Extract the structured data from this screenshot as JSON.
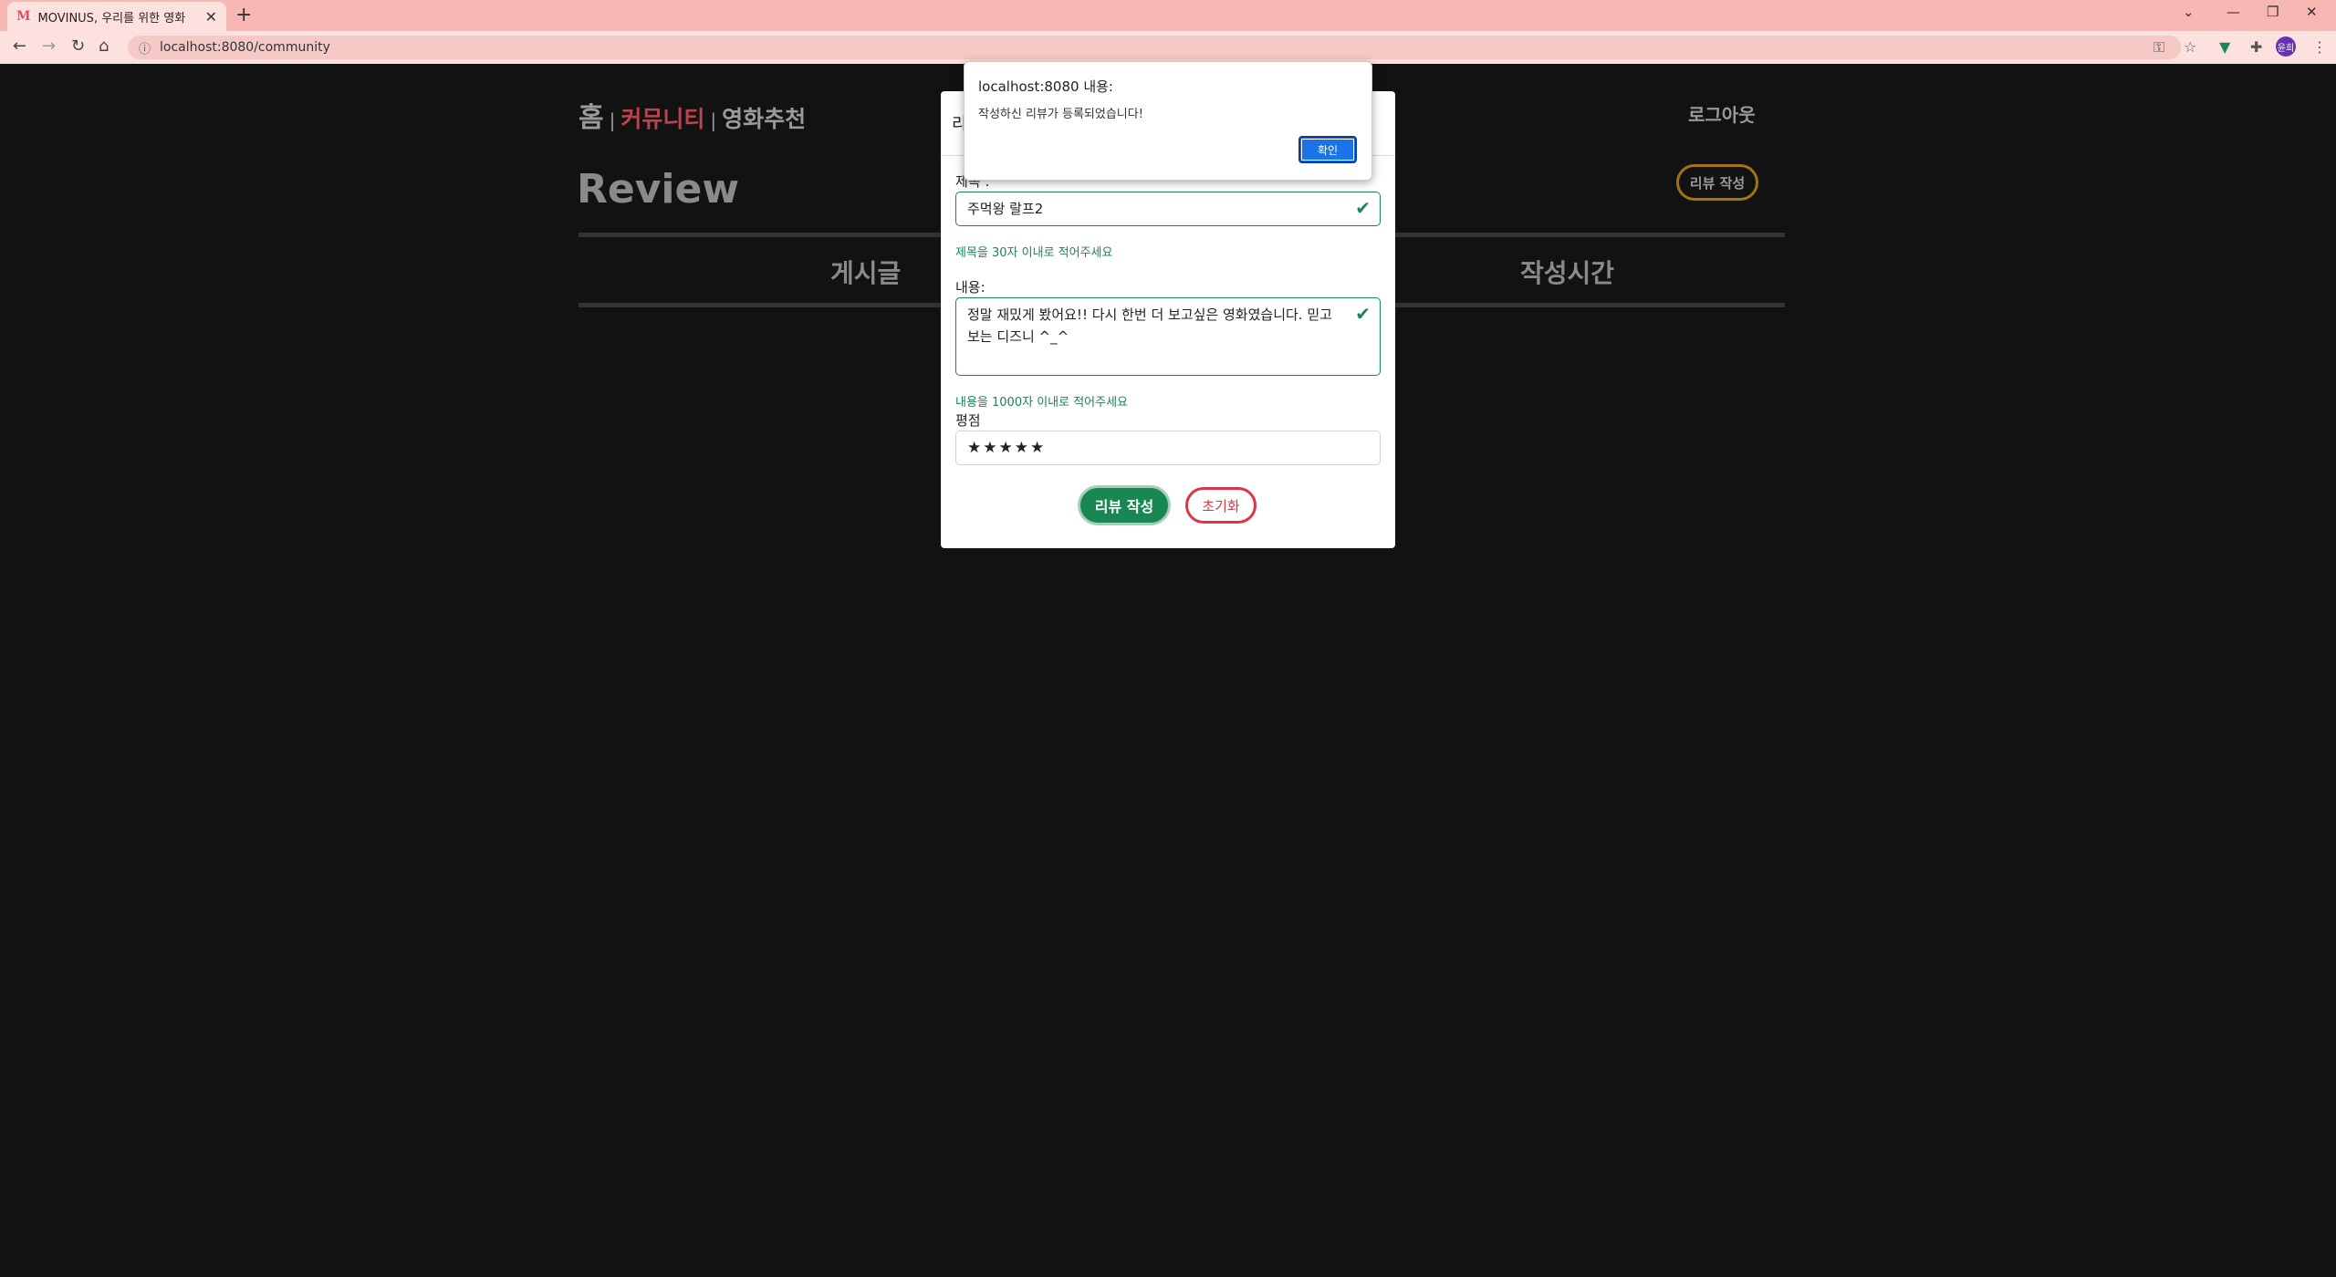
{
  "browser": {
    "tab_title": "MOVINUS, 우리를 위한 영화",
    "favicon": "M",
    "url": "localhost:8080/community",
    "profile_initials": "윤희"
  },
  "nav": {
    "home": "홈",
    "separator": "|",
    "community": "커뮤니티",
    "recommend": "영화추천",
    "logout": "로그아웃"
  },
  "page": {
    "title": "Review",
    "write_button": "리뷰 작성",
    "columns": [
      "게시글",
      "작성시간"
    ]
  },
  "modal": {
    "header_partial": "리",
    "title_label": "제목 :",
    "title_value": "주먹왕 랄프2",
    "title_hint": "제목을 30자 이내로 적어주세요",
    "content_label": "내용:",
    "content_value": "정말 재밌게 봤어요!! 다시 한번 더 보고싶은 영화였습니다. 믿고보는 디즈니 ^_^",
    "content_hint": "내용을 1000자 이내로 적어주세요",
    "rating_label": "평점",
    "rating_value": "★★★★★",
    "submit_label": "리뷰 작성",
    "reset_label": "초기화"
  },
  "alert": {
    "title": "localhost:8080 내용:",
    "message": "작성하신 리뷰가 등록되었습니다!",
    "ok_label": "확인"
  },
  "colors": {
    "background": "#121212",
    "tab_bar": "#f7b7b3",
    "community_accent": "#b8444e",
    "success": "#198754",
    "danger": "#dc3545",
    "write_button_border": "#a07418",
    "alert_button": "#1a73e8"
  }
}
